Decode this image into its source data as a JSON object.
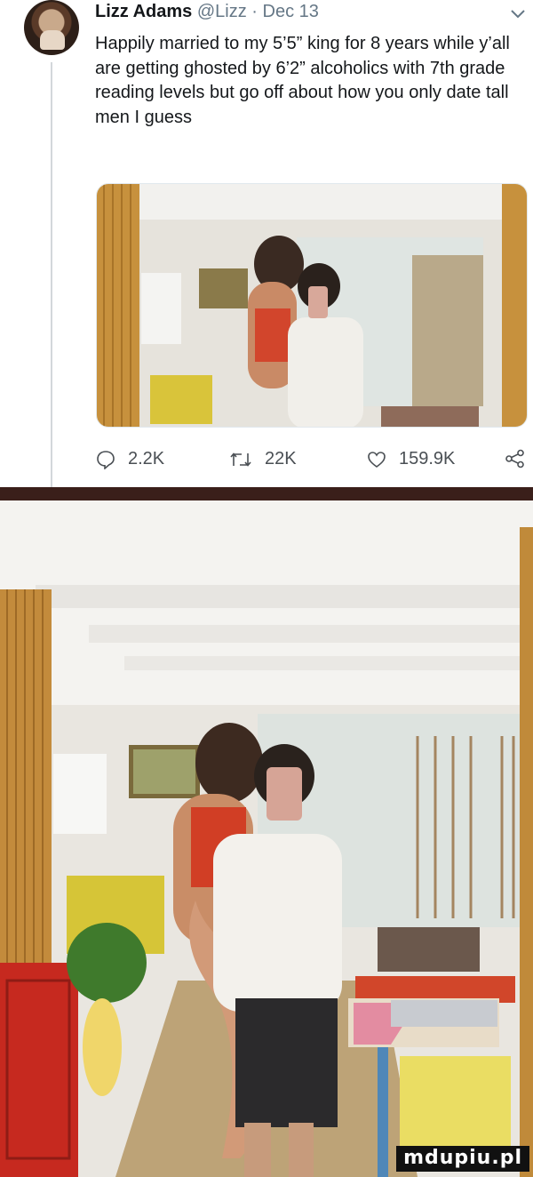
{
  "tweet": {
    "author_name": "Lizz Adams",
    "handle": "@Lizz",
    "date": "Dec 13",
    "separator": "·",
    "text": "Happily married to my 5’5” king for 8 years while y’all are getting ghosted by 6’2” alcoholics with 7th grade reading levels but go off about how you only date tall men I guess",
    "actions": {
      "replies": "2.2K",
      "retweets": "22K",
      "likes": "159.9K"
    },
    "icons": [
      "chevron-down-icon",
      "reply-icon",
      "retweet-icon",
      "like-icon",
      "share-icon"
    ]
  },
  "watermark": "mdupiu.pl",
  "colors": {
    "text": "#14171a",
    "muted": "#657786",
    "divider": "#3a1f1a"
  }
}
